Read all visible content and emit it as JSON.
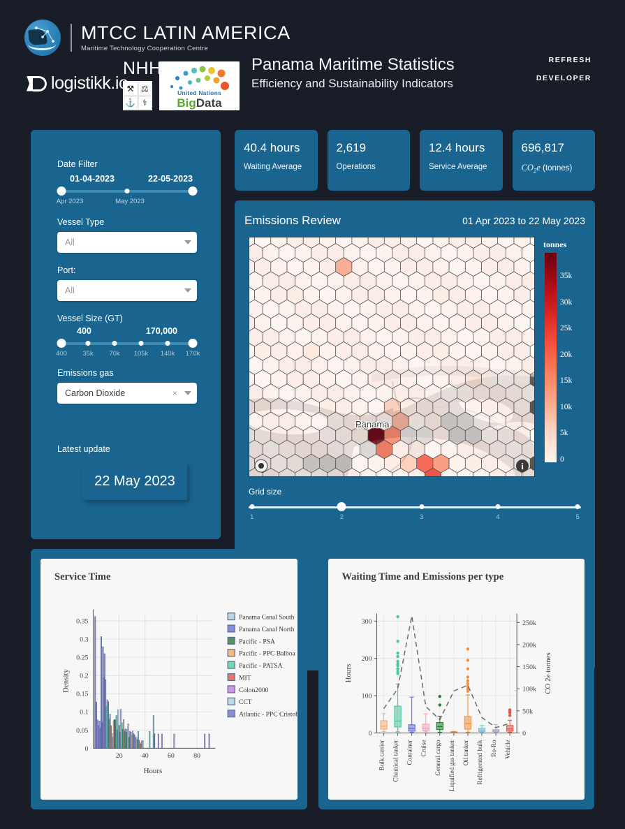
{
  "header": {
    "mtcc_title": "MTCC LATIN AMERICA",
    "mtcc_subtitle": "Maritime Technology Cooperation Centre",
    "logistikk_text": "logistikk.io",
    "nhh_text": "NHH",
    "un_caption": "United Nations",
    "un_big": "Big",
    "un_data": "Data",
    "dashboard_title": "Panama Maritime Statistics",
    "dashboard_subtitle": "Efficiency and Sustainability Indicators",
    "refresh_label": "REFRESH",
    "developer_label": "DEVELOPER"
  },
  "sidebar": {
    "date_filter_label": "Date Filter",
    "date_start": "01-04-2023",
    "date_end": "22-05-2023",
    "date_ticks": [
      "Apr 2023",
      "May 2023"
    ],
    "vessel_type_label": "Vessel Type",
    "vessel_type_value": "All",
    "port_label": "Port:",
    "port_value": "All",
    "vessel_size_label": "Vessel Size (GT)",
    "vessel_size_min": "400",
    "vessel_size_max": "170,000",
    "vessel_size_ticks": [
      "400",
      "35k",
      "70k",
      "105k",
      "140k",
      "170k"
    ],
    "emissions_gas_label": "Emissions gas",
    "emissions_gas_value": "Carbon Dioxide",
    "clear_icon": "×",
    "latest_update_label": "Latest update",
    "latest_update_value": "22 May 2023"
  },
  "kpis": [
    {
      "value": "40.4 hours",
      "label": "Waiting Average"
    },
    {
      "value": "2,619",
      "label": "Operations"
    },
    {
      "value": "12.4 hours",
      "label": "Service Average"
    },
    {
      "value": "696,817",
      "label_prefix": "CO",
      "label_sub": "2",
      "label_mid": "e",
      "label_suffix": " (tonnes)"
    }
  ],
  "map": {
    "title": "Emissions Review",
    "date_range": "01 Apr 2023 to 22 May 2023",
    "country_label": "Panama",
    "legend_title": "tonnes",
    "legend_ticks": [
      "35k",
      "30k",
      "25k",
      "20k",
      "15k",
      "10k",
      "5k",
      "0"
    ],
    "grid_size_label": "Grid size",
    "grid_size_ticks": [
      "1",
      "2",
      "3",
      "4",
      "5"
    ],
    "grid_size_value": 2,
    "zoom_icon": "zoom-icon",
    "info_icon": "info-icon"
  },
  "chart_data": [
    {
      "type": "bar",
      "title": "Service Time",
      "xlabel": "Hours",
      "ylabel": "Density",
      "xlim": [
        0,
        92
      ],
      "ylim": [
        0,
        0.37
      ],
      "xticks": [
        "20",
        "40",
        "60",
        "80"
      ],
      "yticks": [
        "0",
        "0.05",
        "0.1",
        "0.15",
        "0.2",
        "0.25",
        "0.3",
        "0.35"
      ],
      "legend_position": "right",
      "series": [
        {
          "name": "Panama Canal South",
          "color": "#a8cde0"
        },
        {
          "name": "Panama Canal North",
          "color": "#6a70d4"
        },
        {
          "name": "Pacific - PSA",
          "color": "#2c7a37"
        },
        {
          "name": "Pacific - PPC Balboa",
          "color": "#f0a967"
        },
        {
          "name": "Pacific - PATSA",
          "color": "#4ecfa0"
        },
        {
          "name": "MIT",
          "color": "#e3584a"
        },
        {
          "name": "Colon2000",
          "color": "#bd7fe8"
        },
        {
          "name": "CCT",
          "color": "#a9d3e4"
        },
        {
          "name": "Atlantic - PPC Cristobal",
          "color": "#6a70d4"
        }
      ],
      "bars": [
        {
          "x": 1.5,
          "h": 0.362,
          "c": "#6a70d4"
        },
        {
          "x": 2.4,
          "h": 0.127,
          "c": "#6a70d4"
        },
        {
          "x": 3.3,
          "h": 0.078,
          "c": "#6a70d4"
        },
        {
          "x": 4.0,
          "h": 0.062,
          "c": "#bd7fe8"
        },
        {
          "x": 4.8,
          "h": 0.075,
          "c": "#6a70d4"
        },
        {
          "x": 5.5,
          "h": 0.055,
          "c": "#6a70d4"
        },
        {
          "x": 6.2,
          "h": 0.307,
          "c": "#6a70d4"
        },
        {
          "x": 6.9,
          "h": 0.07,
          "c": "#6a70d4"
        },
        {
          "x": 7.5,
          "h": 0.279,
          "c": "#6a70d4"
        },
        {
          "x": 8.2,
          "h": 0.193,
          "c": "#8c93e0"
        },
        {
          "x": 8.8,
          "h": 0.26,
          "c": "#6a70d4"
        },
        {
          "x": 9.5,
          "h": 0.188,
          "c": "#8c93e0"
        },
        {
          "x": 10.2,
          "h": 0.114,
          "c": "#4ecfa0"
        },
        {
          "x": 10.9,
          "h": 0.133,
          "c": "#4ecfa0"
        },
        {
          "x": 11.6,
          "h": 0.128,
          "c": "#3f8fae"
        },
        {
          "x": 12.3,
          "h": 0.08,
          "c": "#2c7a37"
        },
        {
          "x": 13.0,
          "h": 0.094,
          "c": "#7eb2c9"
        },
        {
          "x": 13.7,
          "h": 0.062,
          "c": "#e3584a"
        },
        {
          "x": 14.4,
          "h": 0.04,
          "c": "#a8cde0"
        },
        {
          "x": 15.1,
          "h": 0.03,
          "c": "#6a70d4"
        },
        {
          "x": 15.8,
          "h": 0.076,
          "c": "#f0a967"
        },
        {
          "x": 16.5,
          "h": 0.079,
          "c": "#2c7a37"
        },
        {
          "x": 17.2,
          "h": 0.078,
          "c": "#2c7a37"
        },
        {
          "x": 17.9,
          "h": 0.09,
          "c": "#4ecfa0"
        },
        {
          "x": 18.6,
          "h": 0.05,
          "c": "#6a70d4"
        },
        {
          "x": 19.3,
          "h": 0.106,
          "c": "#a8cde0"
        },
        {
          "x": 20.0,
          "h": 0.063,
          "c": "#2c7a37"
        },
        {
          "x": 20.7,
          "h": 0.043,
          "c": "#6a70d4"
        },
        {
          "x": 21.4,
          "h": 0.107,
          "c": "#a8cde0"
        },
        {
          "x": 22.1,
          "h": 0.07,
          "c": "#4ecfa0"
        },
        {
          "x": 22.8,
          "h": 0.052,
          "c": "#2c7a37"
        },
        {
          "x": 23.5,
          "h": 0.079,
          "c": "#f0a967"
        },
        {
          "x": 24.2,
          "h": 0.047,
          "c": "#2c7a37"
        },
        {
          "x": 24.9,
          "h": 0.053,
          "c": "#6a70d4"
        },
        {
          "x": 25.6,
          "h": 0.044,
          "c": "#2c7a37"
        },
        {
          "x": 26.3,
          "h": 0.052,
          "c": "#a8cde0"
        },
        {
          "x": 27.0,
          "h": 0.067,
          "c": "#f0a967"
        },
        {
          "x": 27.7,
          "h": 0.03,
          "c": "#2c7a37"
        },
        {
          "x": 28.4,
          "h": 0.046,
          "c": "#6a70d4"
        },
        {
          "x": 29.1,
          "h": 0.044,
          "c": "#4ecfa0"
        },
        {
          "x": 29.8,
          "h": 0.035,
          "c": "#f0a967"
        },
        {
          "x": 30.5,
          "h": 0.047,
          "c": "#a8cde0"
        },
        {
          "x": 31.2,
          "h": 0.04,
          "c": "#2c7a37"
        },
        {
          "x": 31.9,
          "h": 0.036,
          "c": "#6a70d4"
        },
        {
          "x": 32.6,
          "h": 0.028,
          "c": "#f0a967"
        },
        {
          "x": 33.3,
          "h": 0.03,
          "c": "#a8cde0"
        },
        {
          "x": 34.0,
          "h": 0.024,
          "c": "#2c7a37"
        },
        {
          "x": 34.7,
          "h": 0.046,
          "c": "#4ecfa0"
        },
        {
          "x": 35.4,
          "h": 0.022,
          "c": "#6a70d4"
        },
        {
          "x": 36.1,
          "h": 0.015,
          "c": "#f0a967"
        },
        {
          "x": 36.8,
          "h": 0.012,
          "c": "#2c7a37"
        },
        {
          "x": 37.5,
          "h": 0.02,
          "c": "#a8a8a8"
        },
        {
          "x": 38.2,
          "h": 0.021,
          "c": "#a8a8a8"
        },
        {
          "x": 43.5,
          "h": 0.046,
          "c": "#4ecfa0"
        },
        {
          "x": 46.5,
          "h": 0.09,
          "c": "#4ecfa0"
        },
        {
          "x": 47.2,
          "h": 0.04,
          "c": "#2f6fa8"
        },
        {
          "x": 50.3,
          "h": 0.039,
          "c": "#bd7fe8"
        },
        {
          "x": 53.0,
          "h": 0.039,
          "c": "#bd7fe8"
        },
        {
          "x": 62.5,
          "h": 0.039,
          "c": "#bd7fe8"
        },
        {
          "x": 86.0,
          "h": 0.039,
          "c": "#bd7fe8"
        },
        {
          "x": 89.5,
          "h": 0.039,
          "c": "#bd7fe8"
        }
      ]
    },
    {
      "type": "boxplot",
      "title": "Waiting Time and Emissions per type",
      "ylabel": "Hours",
      "y2label": "CO 2e tonnes",
      "ylim": [
        0,
        320
      ],
      "y2lim": [
        0,
        270000
      ],
      "yticks": [
        "0",
        "100",
        "200",
        "300"
      ],
      "y2ticks": [
        "0",
        "50k",
        "100k",
        "150k",
        "200k",
        "250k"
      ],
      "categories": [
        "Bulk carrier",
        "Chemical tanker",
        "Container",
        "Cruise",
        "General cargo",
        "Liquified gas tanker",
        "Oil tanker",
        "Refrigerated bulk",
        "Ro-Ro",
        "Vehicle"
      ],
      "boxes": [
        {
          "cat": "Bulk carrier",
          "color": "#f2b277",
          "q1": 10,
          "med": 18,
          "q3": 33,
          "low": 4,
          "high": 52,
          "outliers": []
        },
        {
          "cat": "Chemical tanker",
          "color": "#4cc79b",
          "q1": 16,
          "med": 32,
          "q3": 72,
          "low": 3,
          "high": 131,
          "outliers": [
            312,
            246,
            214,
            205,
            192,
            185,
            180,
            172,
            165,
            159
          ]
        },
        {
          "cat": "Container",
          "color": "#6a70d4",
          "q1": 5,
          "med": 12,
          "q3": 22,
          "low": 2,
          "high": 96,
          "outliers": []
        },
        {
          "cat": "Cruise",
          "color": "#f3a6bd",
          "q1": 6,
          "med": 12,
          "q3": 24,
          "low": 3,
          "high": 51,
          "outliers": []
        },
        {
          "cat": "General cargo",
          "color": "#2c7a37",
          "q1": 9,
          "med": 17,
          "q3": 28,
          "low": 2,
          "high": 45,
          "outliers": [
            98,
            75
          ]
        },
        {
          "cat": "Liquified gas tanker",
          "color": "#e08a3c",
          "q1": 1,
          "med": 2,
          "q3": 3,
          "low": 1,
          "high": 4,
          "outliers": []
        },
        {
          "cat": "Oil tanker",
          "color": "#f0913f",
          "q1": 10,
          "med": 25,
          "q3": 44,
          "low": 2,
          "high": 102,
          "outliers": [
            225,
            195,
            172,
            150,
            140,
            132,
            125,
            118,
            112
          ]
        },
        {
          "cat": "Refrigerated bulk",
          "color": "#7fc3df",
          "q1": 4,
          "med": 8,
          "q3": 13,
          "low": 2,
          "high": 20,
          "outliers": []
        },
        {
          "cat": "Ro-Ro",
          "color": "#b0b0c8",
          "q1": 4,
          "med": 6,
          "q3": 9,
          "low": 2,
          "high": 22,
          "outliers": []
        },
        {
          "cat": "Vehicle",
          "color": "#e3584a",
          "q1": 5,
          "med": 11,
          "q3": 20,
          "low": 2,
          "high": 34,
          "outliers": [
            62,
            58,
            54,
            47
          ]
        }
      ],
      "emissions_line": {
        "name": "CO2e tonnes",
        "style": "dashed",
        "color": "#6b6b6b",
        "values": [
          55000,
          100000,
          265000,
          60000,
          30000,
          95000,
          108000,
          35000,
          12000,
          22000
        ]
      }
    }
  ]
}
